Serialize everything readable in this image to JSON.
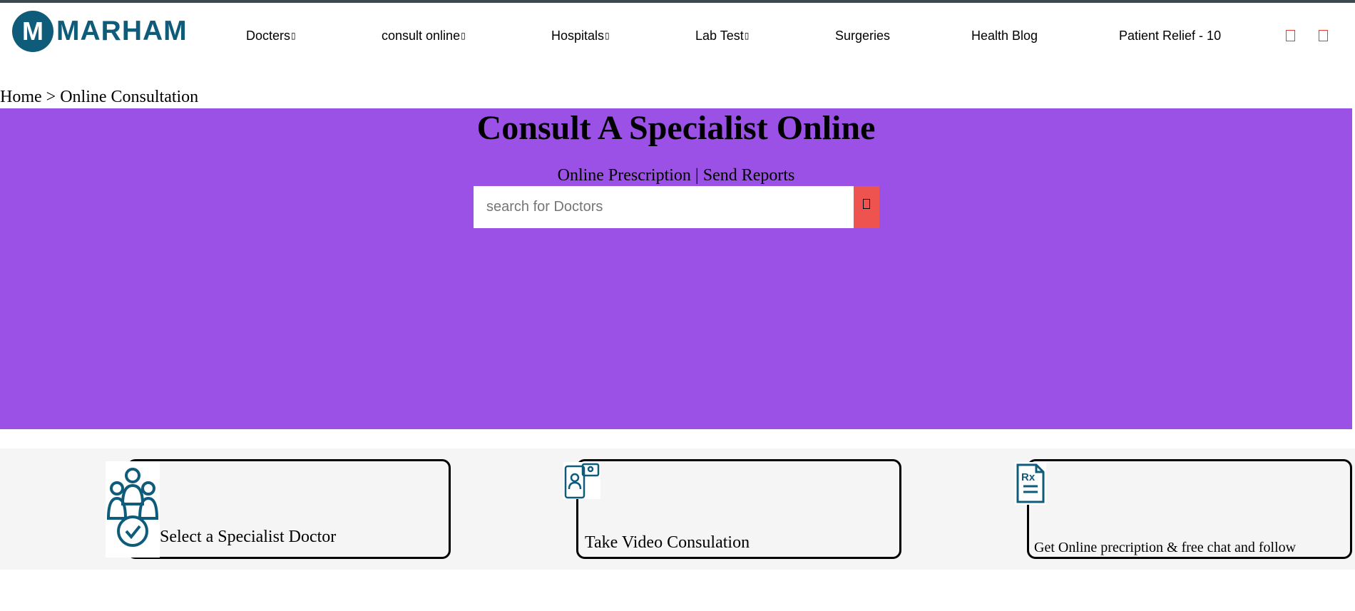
{
  "brand": {
    "name": "MARHAM",
    "mark": "M"
  },
  "nav": {
    "items": [
      {
        "label": "Docters",
        "dropdown": true
      },
      {
        "label": "consult online",
        "dropdown": true
      },
      {
        "label": "Hospitals",
        "dropdown": true
      },
      {
        "label": "Lab Test",
        "dropdown": true
      },
      {
        "label": "Surgeries",
        "dropdown": false
      },
      {
        "label": "Health Blog",
        "dropdown": false
      },
      {
        "label": "Patient Relief - 10",
        "dropdown": false
      }
    ],
    "caret_glyph": "▯",
    "icons": [
      "user-icon",
      "cart-icon"
    ]
  },
  "breadcrumb": {
    "text": "Home > Online Consultation"
  },
  "hero": {
    "title": "Consult A Specialist Online",
    "subtitle": "Online Prescription | Send Reports",
    "search_placeholder": "search for Doctors",
    "background": "#9b51e6"
  },
  "steps": [
    {
      "label": "Select a Specialist Doctor",
      "icon": "doctors-group-icon"
    },
    {
      "label": "Take Video Consulation",
      "icon": "video-call-icon"
    },
    {
      "label": "Get Online precription & free chat and follow",
      "icon": "prescription-icon"
    }
  ],
  "colors": {
    "brand": "#0f5b7a",
    "accent": "#ef5350",
    "hero": "#9b51e6"
  }
}
